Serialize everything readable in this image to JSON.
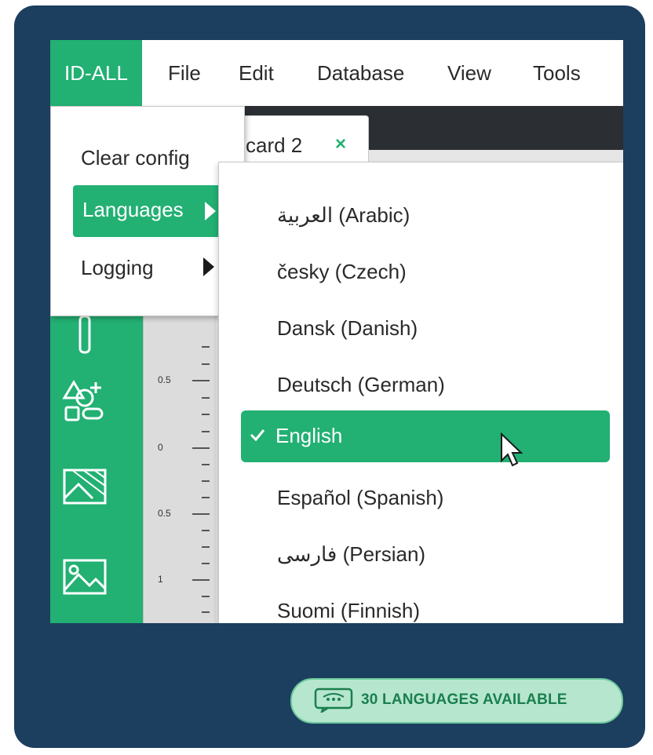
{
  "menubar": {
    "items": [
      "ID-ALL",
      "File",
      "Edit",
      "Database",
      "View",
      "Tools"
    ]
  },
  "tab": {
    "label": "card 2",
    "close_icon": "×"
  },
  "primary_menu": {
    "items": [
      "Clear config",
      "Languages",
      "Logging"
    ],
    "selected": "Languages"
  },
  "languages_menu": {
    "items": [
      "العربية (Arabic)",
      "česky (Czech)",
      "Dansk (Danish)",
      "Deutsch (German)",
      "English",
      "Español (Spanish)",
      "فارسی (Persian)",
      "Suomi (Finnish)"
    ],
    "selected": "English"
  },
  "ruler": {
    "labels": [
      "0.5",
      "0",
      "0.5",
      "1"
    ]
  },
  "badge": {
    "text": "30 LANGUAGES AVAILABLE",
    "icon": "chat-bubble-icon"
  },
  "colors": {
    "accent": "#22b073",
    "frame": "#1c3e5f",
    "badge_bg": "#b6e6ce",
    "badge_text": "#1a7f4f"
  }
}
